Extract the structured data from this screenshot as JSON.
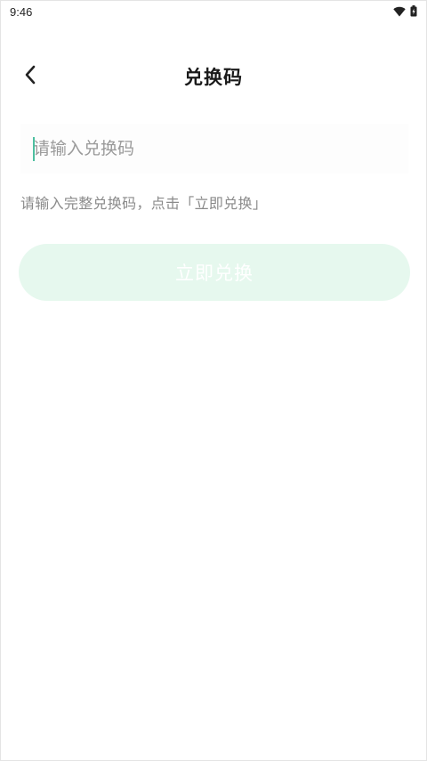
{
  "status_bar": {
    "time": "9:46",
    "icons": [
      "wifi-icon",
      "battery-icon"
    ]
  },
  "header": {
    "title": "兑换码",
    "back_icon": "chevron-left-icon"
  },
  "form": {
    "input_value": "",
    "input_placeholder": "请输入兑换码",
    "hint": "请输入完整兑换码，点击「立即兑换」",
    "submit_label": "立即兑换"
  },
  "colors": {
    "accent": "#4dbfa0",
    "button_disabled_bg": "#e6f8ee",
    "hint_text": "#8a8a8a",
    "title_text": "#1a1a1a"
  }
}
